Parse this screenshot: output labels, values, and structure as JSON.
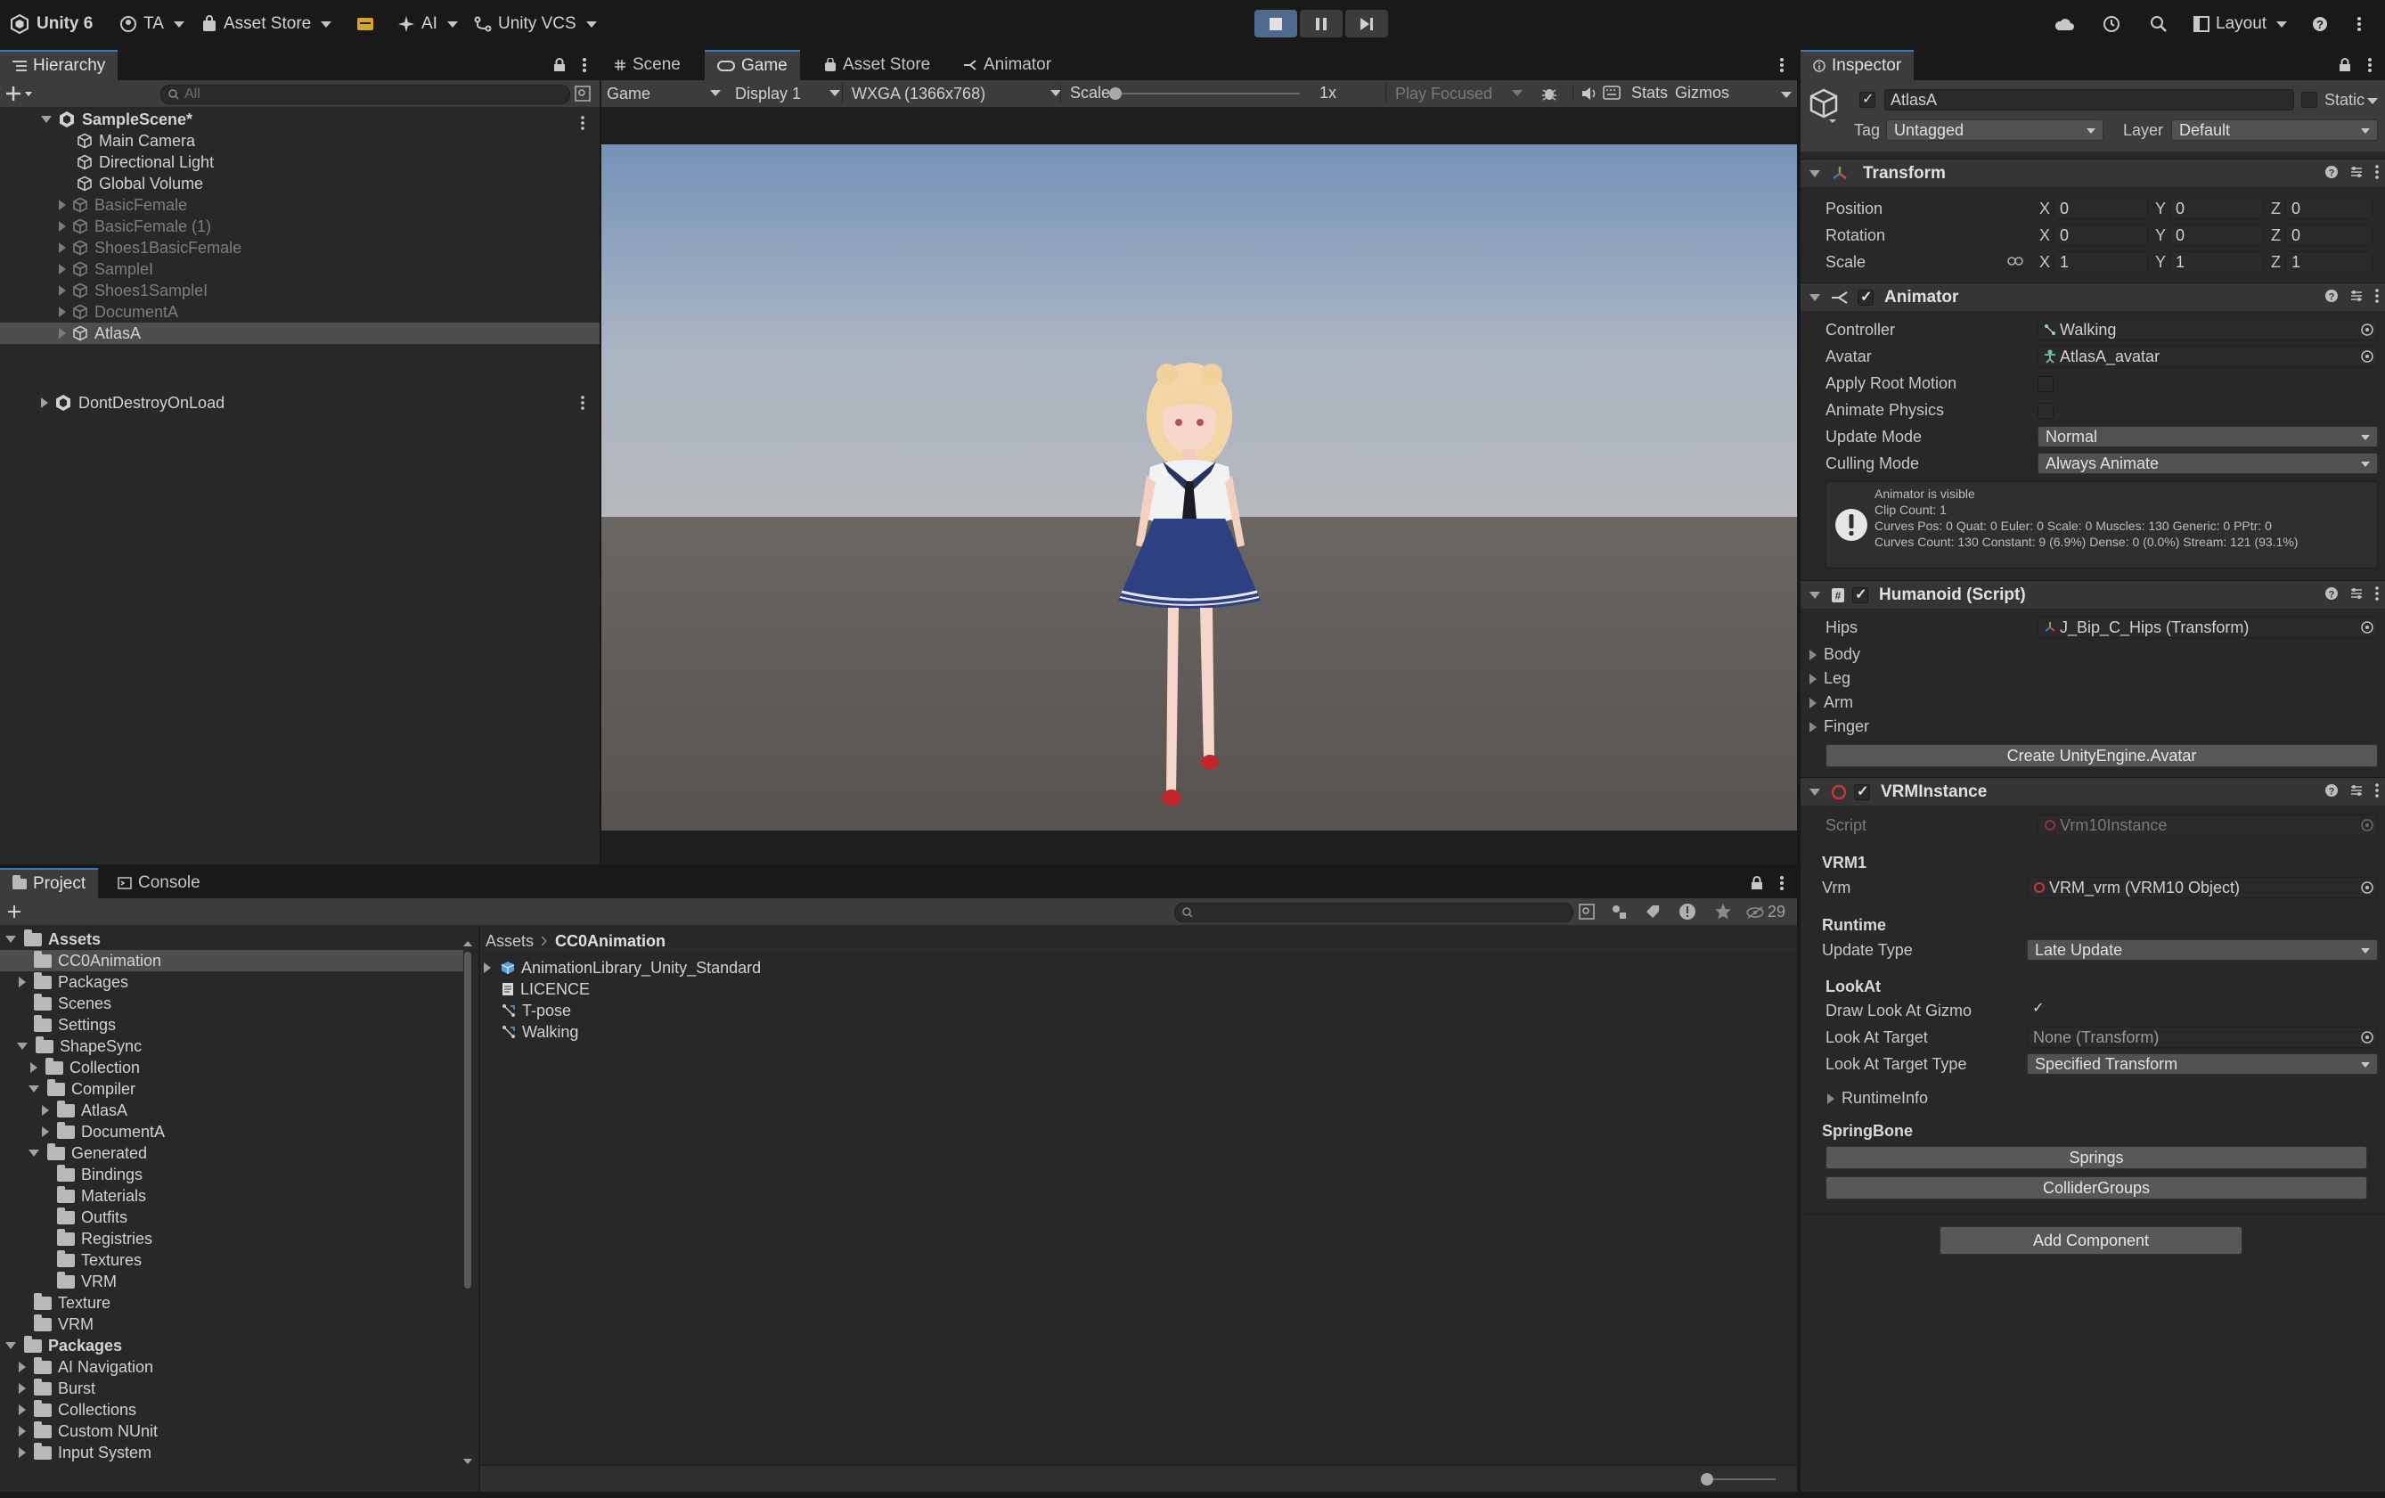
{
  "toolbar": {
    "app": "Unity 6",
    "account": "TA",
    "asset_store": "Asset Store",
    "ai": "AI",
    "vcs": "Unity VCS",
    "layout": "Layout"
  },
  "hierarchy": {
    "tab": "Hierarchy",
    "search_placeholder": "All",
    "scene": "SampleScene*",
    "items": [
      {
        "label": "Main Camera",
        "dim": false
      },
      {
        "label": "Directional Light",
        "dim": false
      },
      {
        "label": "Global Volume",
        "dim": false
      },
      {
        "label": "BasicFemale",
        "dim": true
      },
      {
        "label": "BasicFemale (1)",
        "dim": true
      },
      {
        "label": "Shoes1BasicFemale",
        "dim": true
      },
      {
        "label": "SampleI",
        "dim": true
      },
      {
        "label": "Shoes1SampleI",
        "dim": true
      },
      {
        "label": "DocumentA",
        "dim": true
      },
      {
        "label": "AtlasA",
        "dim": false
      }
    ],
    "dont_destroy": "DontDestroyOnLoad"
  },
  "view_tabs": {
    "scene": "Scene",
    "game": "Game",
    "asset_store": "Asset Store",
    "animator": "Animator"
  },
  "game_toolbar": {
    "mode": "Game",
    "display": "Display 1",
    "resolution": "WXGA (1366x768)",
    "scale_label": "Scale",
    "scale_value": "1x",
    "play_focused": "Play Focused",
    "stats": "Stats",
    "gizmos": "Gizmos"
  },
  "project": {
    "tab_project": "Project",
    "tab_console": "Console",
    "hidden_count": "29",
    "breadcrumb_root": "Assets",
    "breadcrumb_current": "CC0Animation",
    "tree": [
      {
        "label": "Assets",
        "depth": 0,
        "arrow": "down",
        "bold": true
      },
      {
        "label": "CC0Animation",
        "depth": 1,
        "arrow": "none",
        "selected": true
      },
      {
        "label": "Packages",
        "depth": 1,
        "arrow": "right"
      },
      {
        "label": "Scenes",
        "depth": 1,
        "arrow": "none"
      },
      {
        "label": "Settings",
        "depth": 1,
        "arrow": "none"
      },
      {
        "label": "ShapeSync",
        "depth": 1,
        "arrow": "down"
      },
      {
        "label": "Collection",
        "depth": 2,
        "arrow": "right"
      },
      {
        "label": "Compiler",
        "depth": 2,
        "arrow": "down"
      },
      {
        "label": "AtlasA",
        "depth": 3,
        "arrow": "right"
      },
      {
        "label": "DocumentA",
        "depth": 3,
        "arrow": "right"
      },
      {
        "label": "Generated",
        "depth": 2,
        "arrow": "down"
      },
      {
        "label": "Bindings",
        "depth": 3,
        "arrow": "none"
      },
      {
        "label": "Materials",
        "depth": 3,
        "arrow": "none"
      },
      {
        "label": "Outfits",
        "depth": 3,
        "arrow": "none"
      },
      {
        "label": "Registries",
        "depth": 3,
        "arrow": "none"
      },
      {
        "label": "Textures",
        "depth": 3,
        "arrow": "none"
      },
      {
        "label": "VRM",
        "depth": 3,
        "arrow": "none"
      },
      {
        "label": "Texture",
        "depth": 1,
        "arrow": "none"
      },
      {
        "label": "VRM",
        "depth": 1,
        "arrow": "none"
      },
      {
        "label": "Packages",
        "depth": 0,
        "arrow": "down",
        "bold": true
      },
      {
        "label": "AI Navigation",
        "depth": 1,
        "arrow": "right"
      },
      {
        "label": "Burst",
        "depth": 1,
        "arrow": "right"
      },
      {
        "label": "Collections",
        "depth": 1,
        "arrow": "right"
      },
      {
        "label": "Custom NUnit",
        "depth": 1,
        "arrow": "right"
      },
      {
        "label": "Input System",
        "depth": 1,
        "arrow": "right"
      }
    ],
    "files": [
      {
        "label": "AnimationLibrary_Unity_Standard",
        "icon": "model-icon",
        "arrow": true
      },
      {
        "label": "LICENCE",
        "icon": "text-file-icon",
        "arrow": false
      },
      {
        "label": "T-pose",
        "icon": "animation-clip-icon",
        "arrow": false
      },
      {
        "label": "Walking",
        "icon": "animation-clip-icon",
        "arrow": false
      }
    ]
  },
  "inspector": {
    "tab": "Inspector",
    "object_name": "AtlasA",
    "static_label": "Static",
    "tag_label": "Tag",
    "tag_value": "Untagged",
    "layer_label": "Layer",
    "layer_value": "Default",
    "transform": {
      "title": "Transform",
      "position_label": "Position",
      "rotation_label": "Rotation",
      "scale_label": "Scale",
      "x": "X",
      "y": "Y",
      "z": "Z",
      "position": [
        "0",
        "0",
        "0"
      ],
      "rotation": [
        "0",
        "0",
        "0"
      ],
      "scale": [
        "1",
        "1",
        "1"
      ]
    },
    "animator": {
      "title": "Animator",
      "controller_label": "Controller",
      "controller_value": "Walking",
      "avatar_label": "Avatar",
      "avatar_value": "AtlasA_avatar",
      "apply_root_motion_label": "Apply Root Motion",
      "animate_physics_label": "Animate Physics",
      "update_mode_label": "Update Mode",
      "update_mode_value": "Normal",
      "culling_mode_label": "Culling Mode",
      "culling_mode_value": "Always Animate",
      "info_lines": [
        "Animator is visible",
        "Clip Count: 1",
        "Curves Pos: 0 Quat: 0 Euler: 0 Scale: 0 Muscles: 130 Generic: 0 PPtr: 0",
        "Curves Count: 130 Constant: 9 (6.9%) Dense: 0 (0.0%) Stream: 121 (93.1%)"
      ]
    },
    "humanoid": {
      "title": "Humanoid (Script)",
      "hips_label": "Hips",
      "hips_value": "J_Bip_C_Hips (Transform)",
      "foldouts": [
        "Body",
        "Leg",
        "Arm",
        "Finger"
      ],
      "create_button": "Create UnityEngine.Avatar"
    },
    "vrm": {
      "title": "VRMInstance",
      "script_label": "Script",
      "script_value": "Vrm10Instance",
      "vrm1_header": "VRM1",
      "vrm_label": "Vrm",
      "vrm_value": "VRM_vrm (VRM10 Object)",
      "runtime_header": "Runtime",
      "update_type_label": "Update Type",
      "update_type_value": "Late Update",
      "lookat_header": "LookAt",
      "draw_gizmo_label": "Draw Look At Gizmo",
      "look_target_label": "Look At Target",
      "look_target_value": "None (Transform)",
      "look_target_type_label": "Look At Target Type",
      "look_target_type_value": "Specified Transform",
      "runtime_info": "RuntimeInfo",
      "springbone_header": "SpringBone",
      "springs_button": "Springs",
      "collider_button": "ColliderGroups"
    },
    "add_component": "Add Component"
  },
  "colors": {
    "accent": "#3a79bb",
    "selection": "#2c5d87",
    "panel": "#282828",
    "toolbar": "#191919"
  }
}
